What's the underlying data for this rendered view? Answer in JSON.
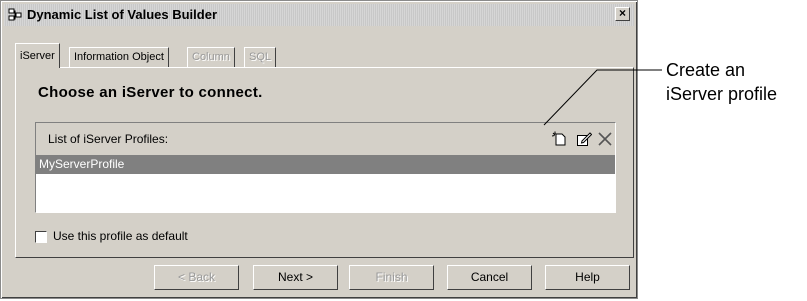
{
  "window": {
    "title": "Dynamic List of Values Builder",
    "close_symbol": "×"
  },
  "tabs": [
    {
      "label": "iServer",
      "state": "active"
    },
    {
      "label": "Information Object",
      "state": "enabled"
    },
    {
      "label": "Column",
      "state": "disabled"
    },
    {
      "label": "SQL",
      "state": "disabled"
    }
  ],
  "heading": "Choose an iServer to connect.",
  "profiles": {
    "header_label": "List of iServer Profiles:",
    "toolbar_icons": [
      "new-profile-icon",
      "edit-profile-icon",
      "delete-profile-icon"
    ],
    "items": [
      {
        "name": "MyServerProfile",
        "selected": true
      }
    ]
  },
  "default_checkbox": {
    "label": "Use this profile as default",
    "checked": false
  },
  "buttons": {
    "back": "< Back",
    "next": "Next >",
    "finish": "Finish",
    "cancel": "Cancel",
    "help": "Help"
  },
  "callout": {
    "line1": "Create an",
    "line2": "iServer profile"
  },
  "colors": {
    "dialog_bg": "#d4d0c8",
    "selected_row": "#808080",
    "disabled_text": "#9a9a9a"
  }
}
